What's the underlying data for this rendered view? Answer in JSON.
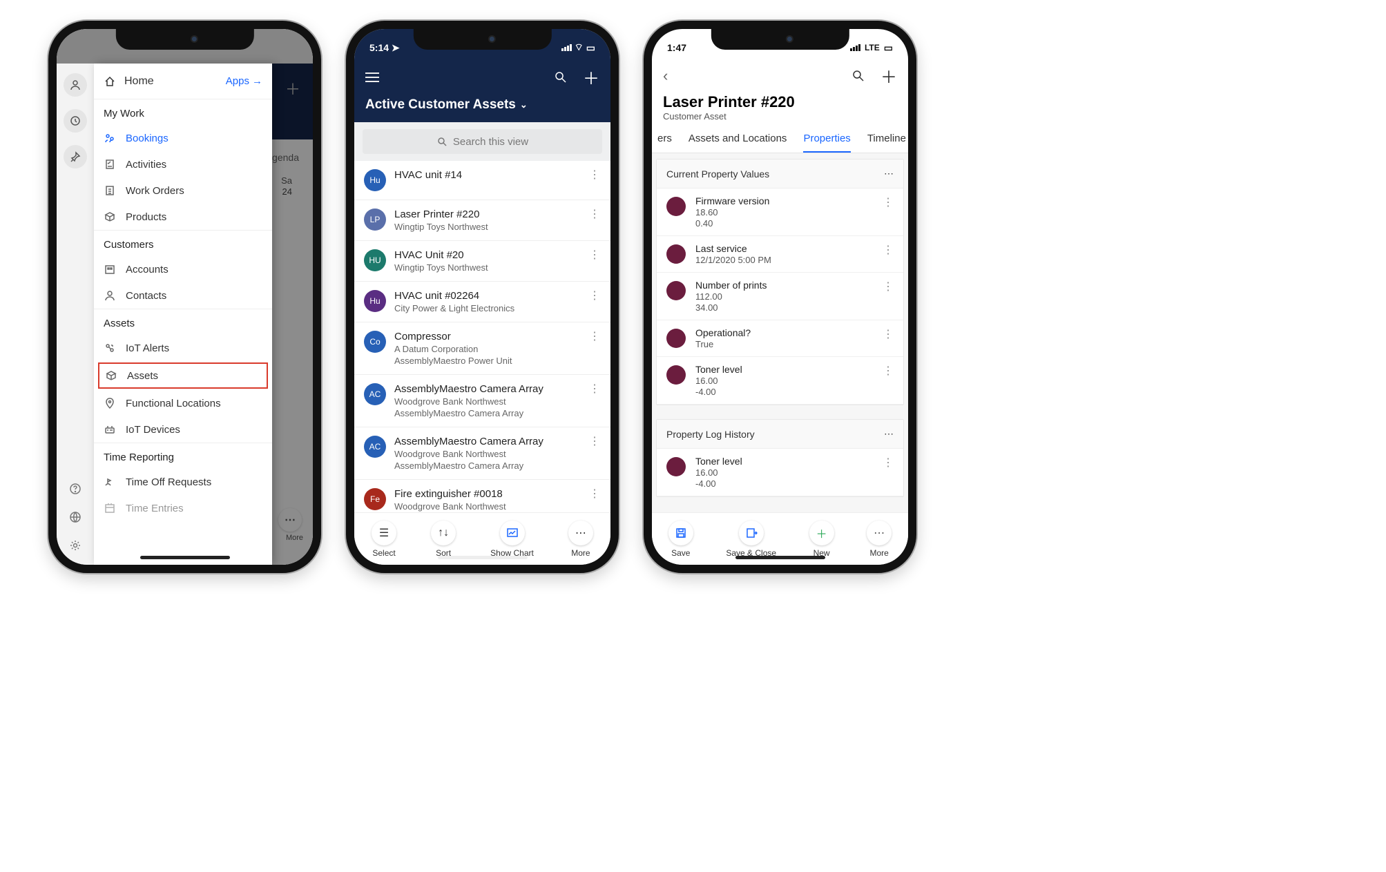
{
  "phone1": {
    "home": "Home",
    "apps": "Apps",
    "sections": {
      "mywork": {
        "title": "My Work",
        "items": [
          "Bookings",
          "Activities",
          "Work Orders",
          "Products"
        ]
      },
      "customers": {
        "title": "Customers",
        "items": [
          "Accounts",
          "Contacts"
        ]
      },
      "assets": {
        "title": "Assets",
        "items": [
          "IoT Alerts",
          "Assets",
          "Functional Locations",
          "IoT Devices"
        ]
      },
      "time": {
        "title": "Time Reporting",
        "items": [
          "Time Off Requests",
          "Time Entries"
        ]
      }
    },
    "bg": {
      "agenda": "Agenda",
      "day": "Sa",
      "date": "24",
      "more": "More"
    }
  },
  "phone2": {
    "time": "5:14",
    "title": "Active Customer Assets",
    "search_placeholder": "Search this view",
    "rows": [
      {
        "avatar": "Hu",
        "color": "#2760b6",
        "title": "HVAC unit #14",
        "sub1": "",
        "sub2": ""
      },
      {
        "avatar": "LP",
        "color": "#5a6faa",
        "title": "Laser Printer #220",
        "sub1": "Wingtip Toys Northwest",
        "sub2": ""
      },
      {
        "avatar": "HU",
        "color": "#1c7a6c",
        "title": "HVAC Unit #20",
        "sub1": "Wingtip Toys Northwest",
        "sub2": ""
      },
      {
        "avatar": "Hu",
        "color": "#5a2d82",
        "title": "HVAC unit #02264",
        "sub1": "City Power & Light Electronics",
        "sub2": ""
      },
      {
        "avatar": "Co",
        "color": "#2760b6",
        "title": "Compressor",
        "sub1": "A Datum Corporation",
        "sub2": "AssemblyMaestro Power Unit"
      },
      {
        "avatar": "AC",
        "color": "#2760b6",
        "title": "AssemblyMaestro Camera Array",
        "sub1": "Woodgrove Bank Northwest",
        "sub2": "AssemblyMaestro Camera Array"
      },
      {
        "avatar": "AC",
        "color": "#2760b6",
        "title": "AssemblyMaestro Camera Array",
        "sub1": "Woodgrove Bank Northwest",
        "sub2": "AssemblyMaestro Camera Array"
      },
      {
        "avatar": "Fe",
        "color": "#a8291c",
        "title": "Fire extinguisher #0018",
        "sub1": "Woodgrove Bank Northwest",
        "sub2": ""
      }
    ],
    "bottom": [
      "Select",
      "Sort",
      "Show Chart",
      "More"
    ]
  },
  "phone3": {
    "time": "1:47",
    "net": "LTE",
    "title": "Laser Printer #220",
    "subtitle": "Customer Asset",
    "tabs": [
      "ers",
      "Assets and Locations",
      "Properties",
      "Timeline"
    ],
    "active_tab": 2,
    "card1_title": "Current Property Values",
    "card1": [
      {
        "name": "Firmware version",
        "v1": "18.60",
        "v2": "0.40"
      },
      {
        "name": "Last service",
        "v1": "12/1/2020 5:00 PM",
        "v2": ""
      },
      {
        "name": "Number of prints",
        "v1": "112.00",
        "v2": "34.00"
      },
      {
        "name": "Operational?",
        "v1": "True",
        "v2": ""
      },
      {
        "name": "Toner level",
        "v1": "16.00",
        "v2": "-4.00"
      }
    ],
    "card2_title": "Property Log History",
    "card2": [
      {
        "name": "Toner level",
        "v1": "16.00",
        "v2": "-4.00"
      }
    ],
    "bottom": [
      "Save",
      "Save & Close",
      "New",
      "More"
    ]
  }
}
